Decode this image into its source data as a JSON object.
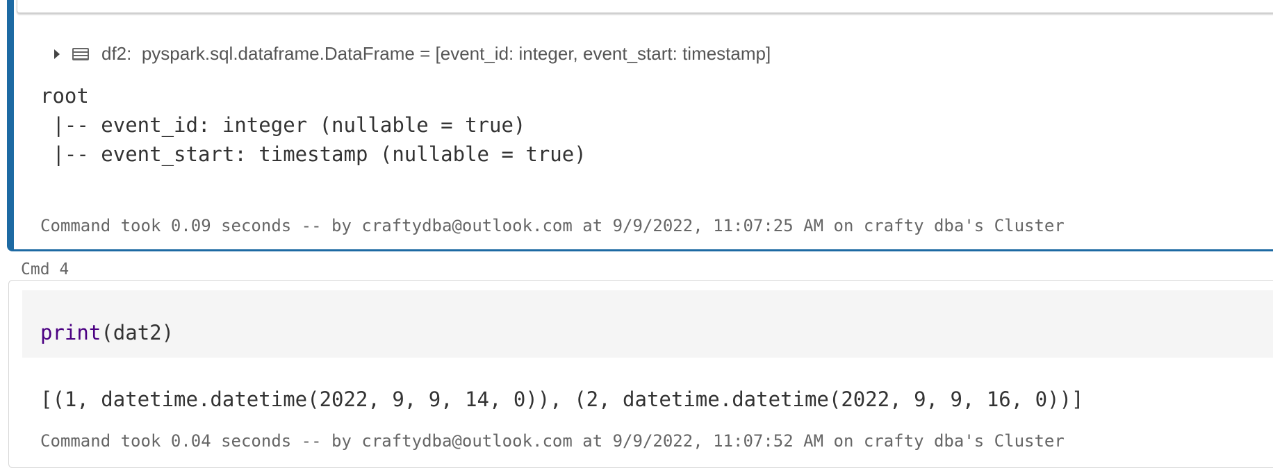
{
  "cell3": {
    "df_label": "df2:",
    "df_schema": "pyspark.sql.dataframe.DataFrame = [event_id: integer, event_start: timestamp]",
    "output_lines": [
      "root",
      " |-- event_id: integer (nullable = true)",
      " |-- event_start: timestamp (nullable = true)"
    ],
    "status": "Command took 0.09 seconds -- by craftydba@outlook.com at 9/9/2022, 11:07:25 AM on crafty dba's Cluster"
  },
  "cell4": {
    "label": "Cmd 4",
    "code_fn": "print",
    "code_args": "(dat2)",
    "output": "[(1, datetime.datetime(2022, 9, 9, 14, 0)), (2, datetime.datetime(2022, 9, 9, 16, 0))]",
    "status": "Command took 0.04 seconds -- by craftydba@outlook.com at 9/9/2022, 11:07:52 AM on crafty dba's Cluster"
  },
  "colors": {
    "active_cell_border": "#1d6aa3",
    "keyword": "#4b0082"
  }
}
